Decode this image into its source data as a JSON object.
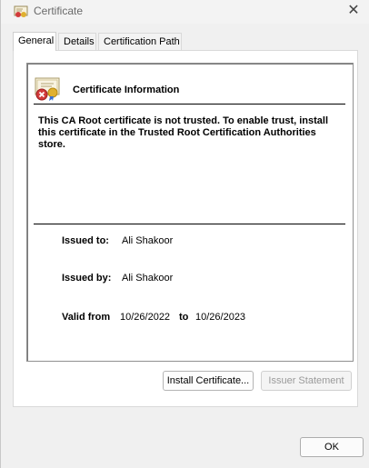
{
  "window": {
    "title": "Certificate",
    "close_glyph": "✕"
  },
  "tabs": [
    {
      "label": "General",
      "active": true
    },
    {
      "label": "Details",
      "active": false
    },
    {
      "label": "Certification Path",
      "active": false
    }
  ],
  "general": {
    "heading": "Certificate Information",
    "warning": "This CA Root certificate is not trusted. To enable trust, install this certificate in the Trusted Root Certification Authorities store.",
    "issued_to_label": "Issued to:",
    "issued_to_value": "Ali Shakoor",
    "issued_by_label": "Issued by:",
    "issued_by_value": "Ali Shakoor",
    "valid_from_label": "Valid from",
    "valid_from_value": "10/26/2022",
    "valid_to_label": "to",
    "valid_to_value": "10/26/2023"
  },
  "buttons": {
    "install": "Install Certificate...",
    "issuer": "Issuer Statement",
    "ok": "OK"
  },
  "icons": {
    "title_icon": "certificate-icon",
    "cert_icon": "untrusted-certificate-icon",
    "close_icon": "close-icon"
  },
  "colors": {
    "error_red": "#d23b3b",
    "seal_gold": "#e0b030"
  }
}
